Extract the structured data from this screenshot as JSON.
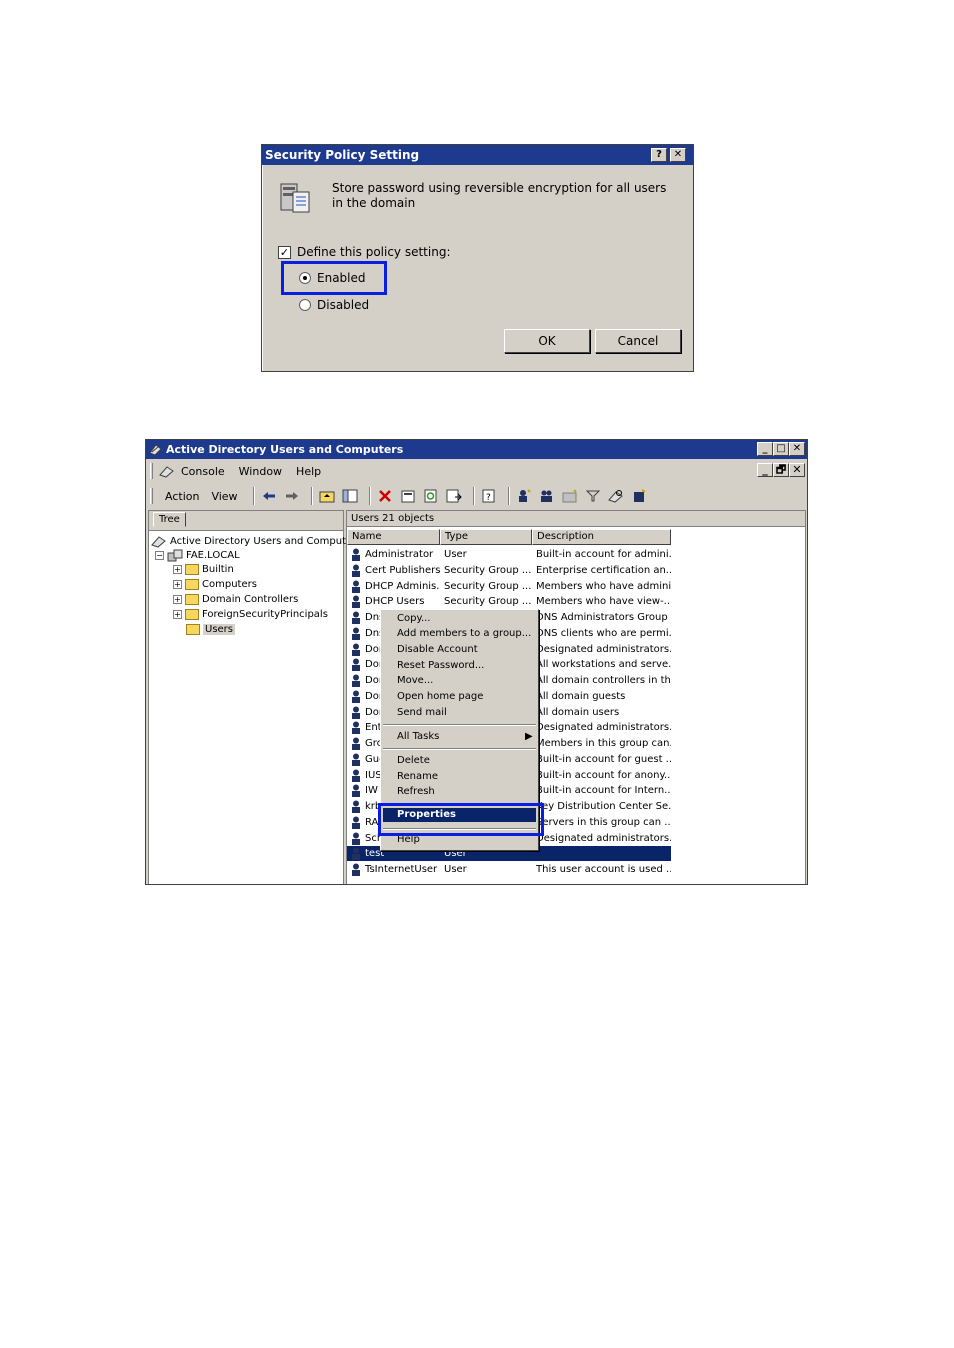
{
  "dialog": {
    "title": "Security Policy Setting",
    "help_btn": "?",
    "close_btn": "✕",
    "description": "Store password using reversible encryption for all users in the domain",
    "define_label": "Define this policy setting:",
    "define_checked": true,
    "enabled_label": "Enabled",
    "disabled_label": "Disabled",
    "selected": "Enabled",
    "ok_label": "OK",
    "cancel_label": "Cancel",
    "highlight_color": "#0a1ee0"
  },
  "window": {
    "title": "Active Directory Users and Computers",
    "controls": [
      "_",
      "□",
      "✕"
    ],
    "mdi_controls": [
      "_",
      "🗗",
      "✕"
    ],
    "menu": [
      "Console",
      "Window",
      "Help"
    ],
    "toolbar_menu": [
      "Action",
      "View"
    ],
    "tree_tab": "Tree",
    "tree": [
      {
        "label": "Active Directory Users and Computers",
        "level": 0,
        "expander": ""
      },
      {
        "label": "FAE.LOCAL",
        "level": 1,
        "expander": "−"
      },
      {
        "label": "Builtin",
        "level": 2,
        "expander": "+"
      },
      {
        "label": "Computers",
        "level": 2,
        "expander": "+"
      },
      {
        "label": "Domain Controllers",
        "level": 2,
        "expander": "+"
      },
      {
        "label": "ForeignSecurityPrincipals",
        "level": 2,
        "expander": "+"
      },
      {
        "label": "Users",
        "level": 2,
        "expander": "",
        "selected": true
      }
    ],
    "list_header": "Users   21 objects",
    "columns": [
      "Name",
      "Type",
      "Description"
    ],
    "rows": [
      {
        "name": "Administrator",
        "type": "User",
        "desc": "Built-in account for admini..."
      },
      {
        "name": "Cert Publishers",
        "type": "Security Group ...",
        "desc": "Enterprise certification an..."
      },
      {
        "name": "DHCP Adminis...",
        "type": "Security Group ...",
        "desc": "Members who have admini..."
      },
      {
        "name": "DHCP Users",
        "type": "Security Group ...",
        "desc": "Members who have view-..."
      },
      {
        "name": "Dns",
        "type": "",
        "desc": "DNS Administrators Group"
      },
      {
        "name": "Dns",
        "type": "",
        "desc": "DNS clients who are permi..."
      },
      {
        "name": "Dor",
        "type": "",
        "desc": "Designated administrators..."
      },
      {
        "name": "Dor",
        "type": "",
        "desc": "All workstations and serve..."
      },
      {
        "name": "Dor",
        "type": "",
        "desc": "All domain controllers in th..."
      },
      {
        "name": "Dor",
        "type": "",
        "desc": "All domain guests"
      },
      {
        "name": "Dor",
        "type": "",
        "desc": "All domain users"
      },
      {
        "name": "Ent",
        "type": "",
        "desc": "Designated administrators..."
      },
      {
        "name": "Grc",
        "type": "",
        "desc": "Members in this group can..."
      },
      {
        "name": "Gue",
        "type": "",
        "desc": "Built-in account for guest ..."
      },
      {
        "name": "IUS",
        "type": "",
        "desc": "Built-in account for anony..."
      },
      {
        "name": "IW",
        "type": "",
        "desc": "Built-in account for Intern..."
      },
      {
        "name": "krb",
        "type": "",
        "desc": "Key Distribution Center Se..."
      },
      {
        "name": "RA",
        "type": "",
        "desc": "Servers in this group can ..."
      },
      {
        "name": "Sch",
        "type": "",
        "desc": "Designated administrators..."
      },
      {
        "name": "test",
        "type": "User",
        "desc": "",
        "selected": true
      },
      {
        "name": "TsInternetUser",
        "type": "User",
        "desc": "This user account is used ..."
      }
    ]
  },
  "context_menu": {
    "items": [
      "Copy...",
      "Add members to a group...",
      "Disable Account",
      "Reset Password...",
      "Move...",
      "Open home page",
      "Send mail"
    ],
    "all_tasks": "All Tasks",
    "submenu_arrow": "▶",
    "items2": [
      "Delete",
      "Rename",
      "Refresh"
    ],
    "properties": "Properties",
    "help": "Help"
  },
  "colors": {
    "titlebar": "#1d3a8f",
    "selection": "#0a246a",
    "face": "#d4d0c8"
  }
}
